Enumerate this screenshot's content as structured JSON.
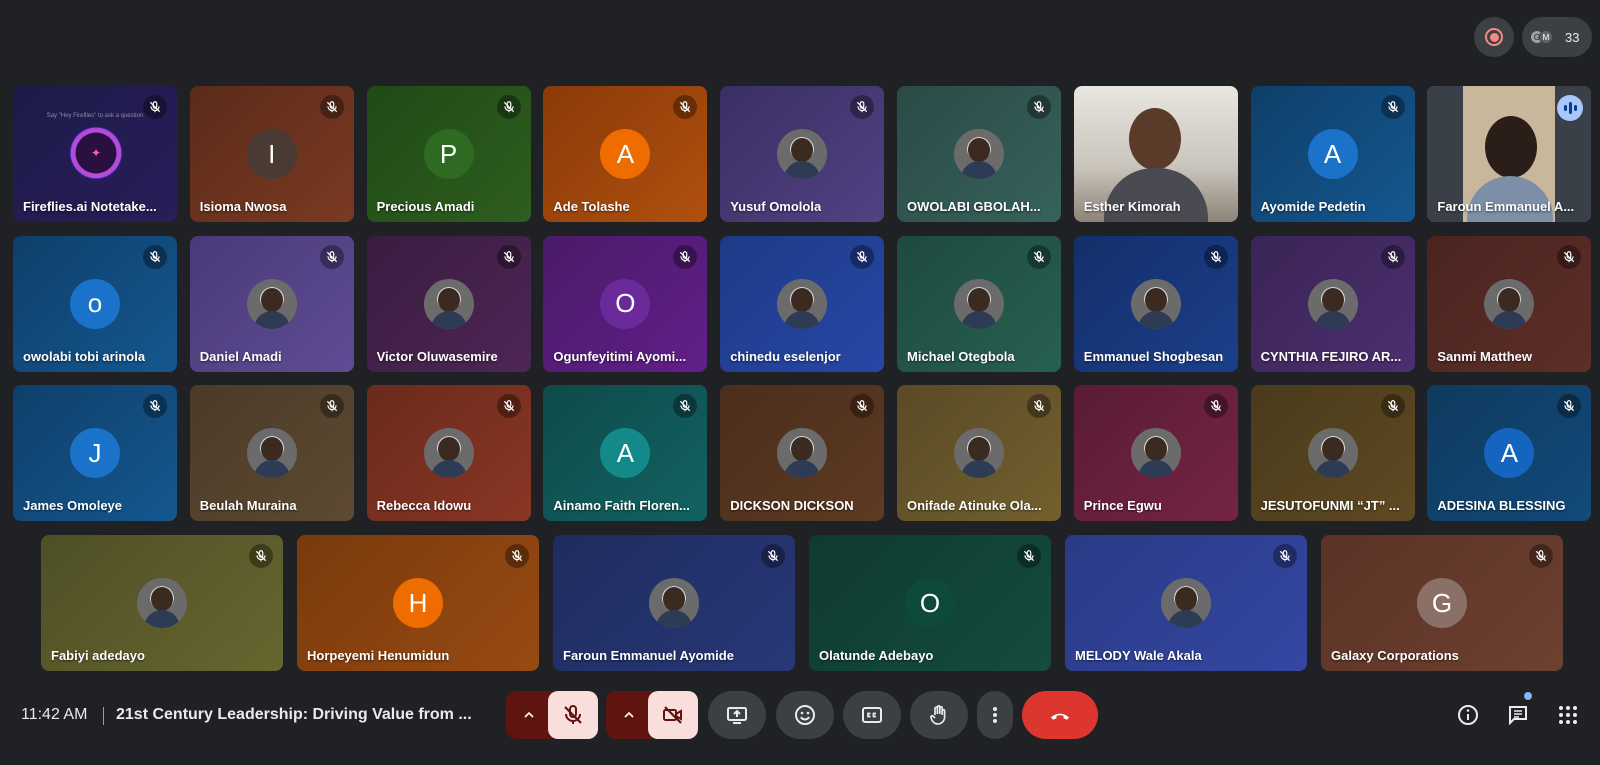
{
  "header": {
    "participant_count": "33",
    "participant_minis": [
      "G",
      "M"
    ]
  },
  "tiles": [
    {
      "name": "Fireflies.ai Notetake...",
      "tagline": "Say \"Hey Fireflies\" to ask a question",
      "colors": [
        "#1c1b4a",
        "#2a1d58"
      ]
    },
    {
      "name": "Isioma Nwosa",
      "initial": "I",
      "colors": [
        "#5b2b1a",
        "#7a3a22"
      ],
      "avatar_color": "#4a3a34"
    },
    {
      "name": "Precious Amadi",
      "initial": "P",
      "colors": [
        "#1f4a16",
        "#2e5e1e"
      ],
      "avatar_color": "#2f6a22"
    },
    {
      "name": "Ade Tolashe",
      "initial": "A",
      "colors": [
        "#8a3a08",
        "#b0500f"
      ],
      "avatar_color": "#ef6c00"
    },
    {
      "name": "Yusuf Omolola",
      "colors": [
        "#3a2f63",
        "#514283"
      ]
    },
    {
      "name": "OWOLABI GBOLAH...",
      "colors": [
        "#2b4a46",
        "#37625c"
      ]
    },
    {
      "name": "Esther Kimorah",
      "video": true
    },
    {
      "name": "Ayomide Pedetin",
      "initial": "A",
      "colors": [
        "#0f3f6a",
        "#14578f"
      ],
      "avatar_color": "#1a73c8"
    },
    {
      "name": "Faroun Emmanuel A...",
      "video": true,
      "speaking": true
    },
    {
      "name": "owolabi tobi arinola",
      "initial": "o",
      "colors": [
        "#0f3f6a",
        "#14578f"
      ],
      "avatar_color": "#1a73c8"
    },
    {
      "name": "Daniel Amadi",
      "colors": [
        "#4a3a78",
        "#5f4c95"
      ]
    },
    {
      "name": "Victor Oluwasemire",
      "colors": [
        "#3a1c40",
        "#4e2656"
      ]
    },
    {
      "name": "Ogunfeyitimi Ayomi...",
      "initial": "O",
      "colors": [
        "#4a1a68",
        "#621f8a"
      ],
      "avatar_color": "#6a2a9a"
    },
    {
      "name": "chinedu eselenjor",
      "colors": [
        "#1e3a86",
        "#2647a6"
      ]
    },
    {
      "name": "Michael Otegbola",
      "colors": [
        "#1e4a3e",
        "#276052"
      ]
    },
    {
      "name": "Emmanuel Shogbesan",
      "colors": [
        "#142f6a",
        "#1b3f8a"
      ]
    },
    {
      "name": "CYNTHIA FEJIRO AR...",
      "colors": [
        "#3a2456",
        "#4c2f6e"
      ]
    },
    {
      "name": "Sanmi Matthew",
      "colors": [
        "#4a2420",
        "#5e2e28"
      ]
    },
    {
      "name": "James Omoleye",
      "initial": "J",
      "colors": [
        "#0f3f6a",
        "#14578f"
      ],
      "avatar_color": "#1a73c8"
    },
    {
      "name": "Beulah Muraina",
      "colors": [
        "#4a3a28",
        "#5e4a32"
      ]
    },
    {
      "name": "Rebecca Idowu",
      "colors": [
        "#6a2a1c",
        "#8a3624"
      ]
    },
    {
      "name": "Ainamo Faith Floren...",
      "initial": "A",
      "colors": [
        "#0f4a4a",
        "#126262"
      ],
      "avatar_color": "#13898a"
    },
    {
      "name": "DICKSON DICKSON",
      "colors": [
        "#4a2e1c",
        "#5e3a22"
      ]
    },
    {
      "name": "Onifade Atinuke Ola...",
      "colors": [
        "#5a4a26",
        "#72602e"
      ]
    },
    {
      "name": "Prince Egwu",
      "colors": [
        "#5a1c34",
        "#742444"
      ]
    },
    {
      "name": "JESUTOFUNMI “JT” ...",
      "colors": [
        "#4a3a1c",
        "#5e4a22"
      ]
    },
    {
      "name": "ADESINA BLESSING",
      "initial": "A",
      "colors": [
        "#0f3a5e",
        "#124a7a"
      ],
      "avatar_color": "#1565c0"
    },
    {
      "name": "Fabiyi adedayo",
      "colors": [
        "#4f4f26",
        "#66662f"
      ]
    },
    {
      "name": "Horpeyemi Henumidun",
      "initial": "H",
      "colors": [
        "#7a3a0c",
        "#984a12"
      ],
      "avatar_color": "#ef6c00"
    },
    {
      "name": "Faroun Emmanuel Ayomide",
      "colors": [
        "#1f2c5e",
        "#283878"
      ]
    },
    {
      "name": "Olatunde Adebayo",
      "initial": "O",
      "colors": [
        "#0f3a30",
        "#144c3f"
      ],
      "avatar_color": "#0e4a3c"
    },
    {
      "name": "MELODY Wale Akala",
      "colors": [
        "#2a3a86",
        "#3447a2"
      ]
    },
    {
      "name": "Galaxy Corporations",
      "initial": "G",
      "colors": [
        "#5a3326",
        "#6e4030"
      ],
      "avatar_color": "#8a7066"
    }
  ],
  "footer": {
    "time": "11:42 AM",
    "meeting_title": "21st Century Leadership: Driving Value from ...",
    "controls": [
      "mic-options",
      "mic-off",
      "camera-options",
      "camera-off",
      "present-screen",
      "emoji-reactions",
      "captions",
      "raise-hand",
      "more-options",
      "leave-call"
    ],
    "side": [
      "meeting-details",
      "chat",
      "activities"
    ]
  }
}
